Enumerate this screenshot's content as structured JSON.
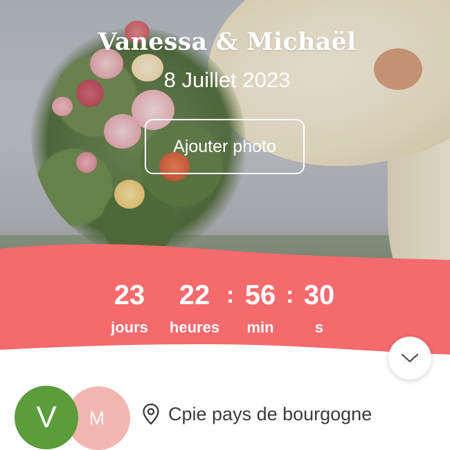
{
  "couple": {
    "names": "Vanessa & Michaël",
    "date": "8 Juillet 2023"
  },
  "hero": {
    "add_photo_label": "Ajouter photo"
  },
  "countdown": {
    "band_color": "#f46a6d",
    "days": {
      "value": "23",
      "label": "jours"
    },
    "hours": {
      "value": "22",
      "label": "heures"
    },
    "minutes": {
      "value": "56",
      "label": "min"
    },
    "seconds": {
      "value": "30",
      "label": "s"
    },
    "separator": ":"
  },
  "expand_icon": "chevron-down-icon",
  "avatars": {
    "partner_1": {
      "initial": "V",
      "color": "#5b9c3b"
    },
    "partner_2": {
      "initial": "M",
      "color": "#f2b6b1"
    }
  },
  "location": {
    "icon": "map-pin-icon",
    "name": "Cpie pays de bourgogne"
  }
}
